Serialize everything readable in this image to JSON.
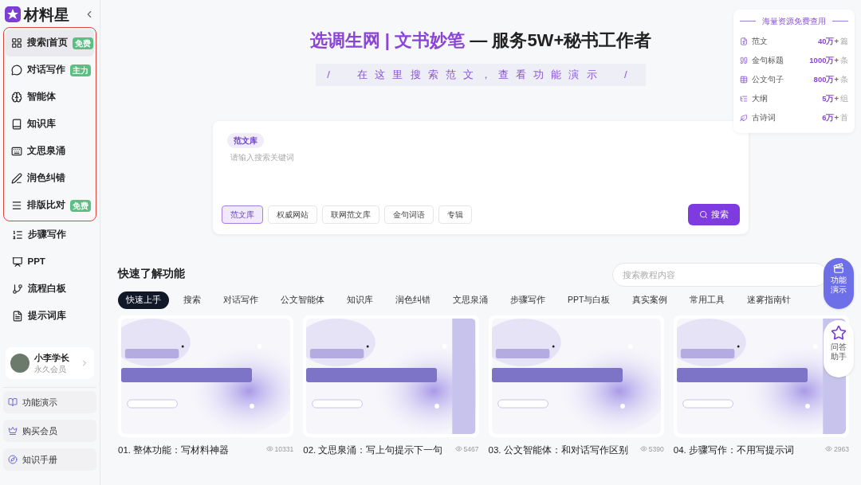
{
  "logo": {
    "text": "材料星"
  },
  "sidebar": {
    "framed_items": [
      {
        "label": "搜索|首页",
        "badge": "免费",
        "selected": true
      },
      {
        "label": "对话写作",
        "badge": "主力",
        "selected": false
      },
      {
        "label": "智能体",
        "selected": false
      },
      {
        "label": "知识库",
        "selected": false
      },
      {
        "label": "文思泉涌",
        "selected": false
      },
      {
        "label": "润色纠错",
        "selected": false
      },
      {
        "label": "排版比对",
        "badge": "免费",
        "selected": false
      }
    ],
    "items": [
      {
        "label": "步骤写作",
        "selected": false
      },
      {
        "label": "PPT",
        "selected": false
      },
      {
        "label": "流程白板",
        "selected": false
      },
      {
        "label": "提示词库",
        "selected": false
      }
    ]
  },
  "user": {
    "name": "小李学长",
    "level": "永久会员"
  },
  "footer_links": [
    {
      "label": "功能演示"
    },
    {
      "label": "购买会员"
    },
    {
      "label": "知识手册"
    }
  ],
  "hero": {
    "brand": "选调生网 | 文书妙笔",
    "slogan": "— 服务5W+秘书工作者",
    "banner": "/  在这里搜索范文，查看功能演示  /"
  },
  "search": {
    "tag": "范文库",
    "placeholder": "请输入搜索关键词",
    "button": "搜索",
    "sources": [
      {
        "label": "范文库",
        "selected": true
      },
      {
        "label": "权威网站",
        "selected": false
      },
      {
        "label": "联网范文库",
        "selected": false
      },
      {
        "label": "金句词语",
        "selected": false
      },
      {
        "label": "专辑",
        "selected": false
      }
    ]
  },
  "stats": {
    "title": "海量资源免费查用",
    "items": [
      {
        "label": "范文",
        "value": "40万+",
        "unit": "篇"
      },
      {
        "label": "金句标题",
        "value": "1000万+",
        "unit": "条"
      },
      {
        "label": "公文句子",
        "value": "800万+",
        "unit": "条"
      },
      {
        "label": "大纲",
        "value": "5万+",
        "unit": "组"
      },
      {
        "label": "古诗词",
        "value": "6万+",
        "unit": "首"
      }
    ]
  },
  "tutorials": {
    "title": "快速了解功能",
    "search_placeholder": "搜索教程内容",
    "tabs": [
      {
        "label": "快速上手",
        "selected": true
      },
      {
        "label": "搜索",
        "selected": false
      },
      {
        "label": "对话写作",
        "selected": false
      },
      {
        "label": "公文智能体",
        "selected": false
      },
      {
        "label": "知识库",
        "selected": false
      },
      {
        "label": "润色纠错",
        "selected": false
      },
      {
        "label": "文思泉涌",
        "selected": false
      },
      {
        "label": "步骤写作",
        "selected": false
      },
      {
        "label": "PPT与白板",
        "selected": false
      },
      {
        "label": "真实案例",
        "selected": false
      },
      {
        "label": "常用工具",
        "selected": false
      },
      {
        "label": "迷雾指南针",
        "selected": false
      }
    ],
    "videos": [
      {
        "title": "01. 整体功能：写材料神器",
        "views": "10331",
        "kind": "picture"
      },
      {
        "title": "02. 文思泉涌：写上句提示下一句",
        "views": "5467",
        "kind": "picture"
      },
      {
        "title": "03. 公文智能体：和对话写作区别",
        "views": "5390",
        "kind": "picture"
      },
      {
        "title": "04. 步骤写作：不用写提示词",
        "views": "2963",
        "kind": "picture"
      }
    ]
  },
  "floating": [
    {
      "label": "功能演示"
    },
    {
      "label": "问答助手"
    }
  ]
}
